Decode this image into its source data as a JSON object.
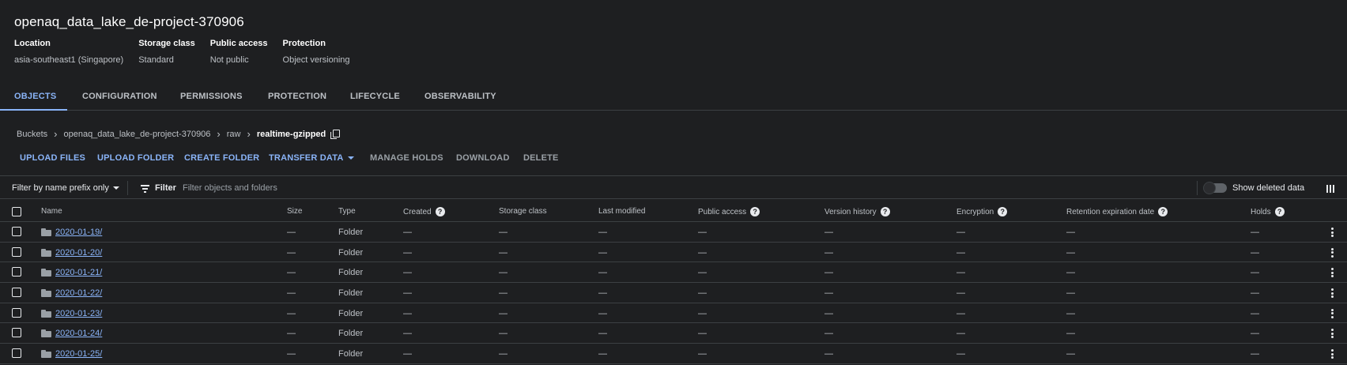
{
  "bucket": {
    "title": "openaq_data_lake_de-project-370906",
    "meta": [
      {
        "label": "Location",
        "value": "asia-southeast1 (Singapore)"
      },
      {
        "label": "Storage class",
        "value": "Standard"
      },
      {
        "label": "Public access",
        "value": "Not public"
      },
      {
        "label": "Protection",
        "value": "Object versioning"
      }
    ]
  },
  "tabs": [
    "OBJECTS",
    "CONFIGURATION",
    "PERMISSIONS",
    "PROTECTION",
    "LIFECYCLE",
    "OBSERVABILITY"
  ],
  "active_tab": "OBJECTS",
  "breadcrumb": {
    "items": [
      "Buckets",
      "openaq_data_lake_de-project-370906",
      "raw"
    ],
    "current": "realtime-gzipped"
  },
  "actions": {
    "upload_files": "UPLOAD FILES",
    "upload_folder": "UPLOAD FOLDER",
    "create_folder": "CREATE FOLDER",
    "transfer_data": "TRANSFER DATA",
    "manage_holds": "MANAGE HOLDS",
    "download": "DOWNLOAD",
    "delete": "DELETE"
  },
  "filter": {
    "prefix_label": "Filter by name prefix only",
    "label": "Filter",
    "placeholder": "Filter objects and folders",
    "show_deleted_label": "Show deleted data"
  },
  "table": {
    "headers": {
      "name": "Name",
      "size": "Size",
      "type": "Type",
      "created": "Created",
      "storage_class": "Storage class",
      "last_modified": "Last modified",
      "public_access": "Public access",
      "version_history": "Version history",
      "encryption": "Encryption",
      "retention": "Retention expiration date",
      "holds": "Holds"
    },
    "rows": [
      {
        "name": "2020-01-19/",
        "size": "—",
        "type": "Folder",
        "created": "—",
        "storage_class": "—",
        "last_modified": "—",
        "public_access": "—",
        "version_history": "—",
        "encryption": "—",
        "retention": "—",
        "holds": "—"
      },
      {
        "name": "2020-01-20/",
        "size": "—",
        "type": "Folder",
        "created": "—",
        "storage_class": "—",
        "last_modified": "—",
        "public_access": "—",
        "version_history": "—",
        "encryption": "—",
        "retention": "—",
        "holds": "—"
      },
      {
        "name": "2020-01-21/",
        "size": "—",
        "type": "Folder",
        "created": "—",
        "storage_class": "—",
        "last_modified": "—",
        "public_access": "—",
        "version_history": "—",
        "encryption": "—",
        "retention": "—",
        "holds": "—"
      },
      {
        "name": "2020-01-22/",
        "size": "—",
        "type": "Folder",
        "created": "—",
        "storage_class": "—",
        "last_modified": "—",
        "public_access": "—",
        "version_history": "—",
        "encryption": "—",
        "retention": "—",
        "holds": "—"
      },
      {
        "name": "2020-01-23/",
        "size": "—",
        "type": "Folder",
        "created": "—",
        "storage_class": "—",
        "last_modified": "—",
        "public_access": "—",
        "version_history": "—",
        "encryption": "—",
        "retention": "—",
        "holds": "—"
      },
      {
        "name": "2020-01-24/",
        "size": "—",
        "type": "Folder",
        "created": "—",
        "storage_class": "—",
        "last_modified": "—",
        "public_access": "—",
        "version_history": "—",
        "encryption": "—",
        "retention": "—",
        "holds": "—"
      },
      {
        "name": "2020-01-25/",
        "size": "—",
        "type": "Folder",
        "created": "—",
        "storage_class": "—",
        "last_modified": "—",
        "public_access": "—",
        "version_history": "—",
        "encryption": "—",
        "retention": "—",
        "holds": "—"
      }
    ]
  },
  "colors": {
    "background": "#1e1f21",
    "accent": "#8ab4f8",
    "text": "#e8eaed",
    "muted": "#bdc1c6",
    "divider": "#3c4043"
  }
}
